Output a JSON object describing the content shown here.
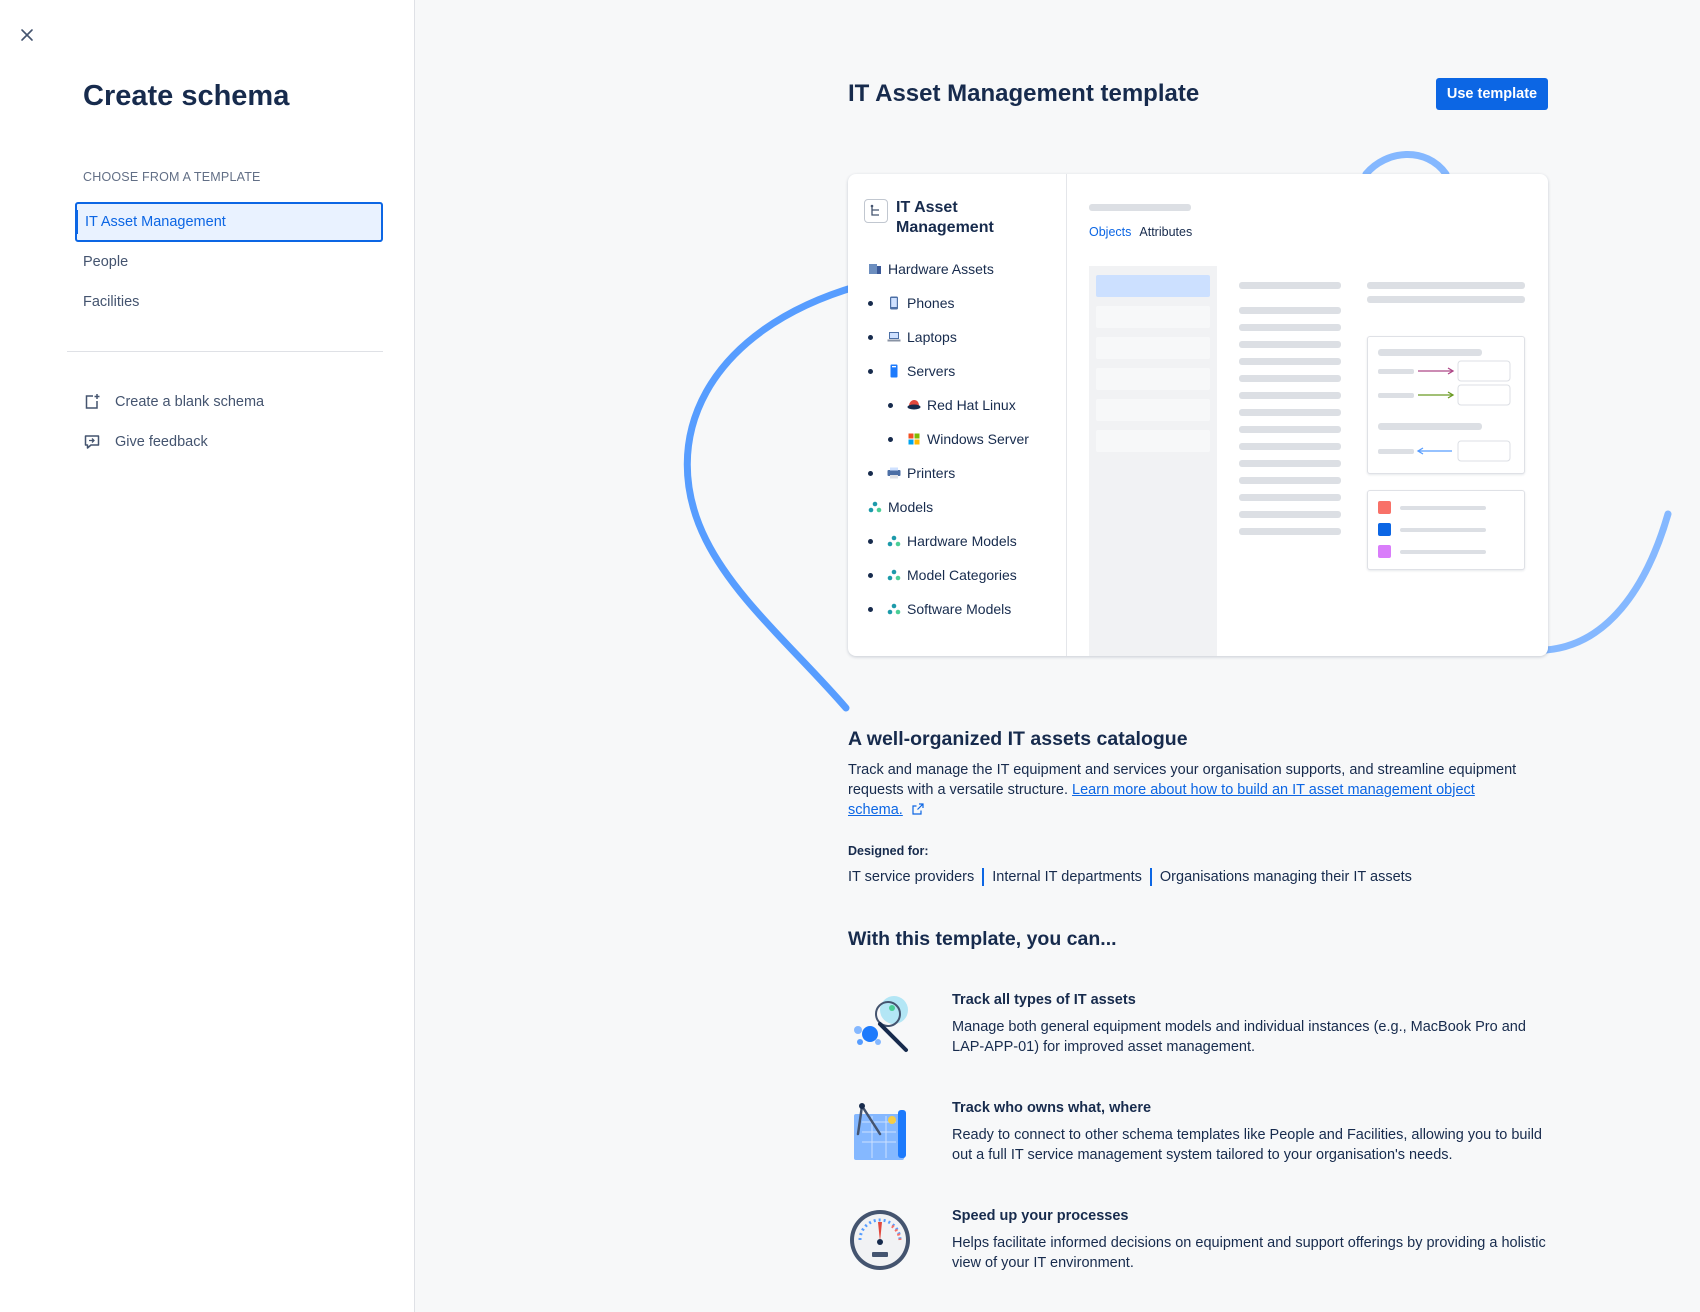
{
  "sidebar": {
    "title": "Create schema",
    "section_label": "CHOOSE FROM A TEMPLATE",
    "templates": [
      {
        "label": "IT Asset Management",
        "selected": true
      },
      {
        "label": "People",
        "selected": false
      },
      {
        "label": "Facilities",
        "selected": false
      }
    ],
    "actions": {
      "blank": "Create a blank schema",
      "feedback": "Give feedback"
    }
  },
  "main": {
    "title": "IT Asset Management template",
    "use_button": "Use template",
    "preview": {
      "tree_title": "IT Asset Management",
      "tabs": [
        "Objects",
        "Attributes"
      ],
      "tree": [
        {
          "label": "Hardware Assets",
          "level": 0,
          "icon": "server-rack-icon"
        },
        {
          "label": "Phones",
          "level": 1,
          "icon": "phone-icon"
        },
        {
          "label": "Laptops",
          "level": 1,
          "icon": "laptop-icon"
        },
        {
          "label": "Servers",
          "level": 1,
          "icon": "server-icon"
        },
        {
          "label": "Red Hat Linux",
          "level": 2,
          "icon": "redhat-icon"
        },
        {
          "label": "Windows Server",
          "level": 2,
          "icon": "windows-icon"
        },
        {
          "label": "Printers",
          "level": 1,
          "icon": "printer-icon"
        },
        {
          "label": "Models",
          "level": 0,
          "icon": "models-icon"
        },
        {
          "label": "Hardware Models",
          "level": 1,
          "icon": "models-icon"
        },
        {
          "label": "Model Categories",
          "level": 1,
          "icon": "models-icon"
        },
        {
          "label": "Software Models",
          "level": 1,
          "icon": "models-icon"
        }
      ]
    },
    "catalogue": {
      "heading": "A well-organized IT assets catalogue",
      "text": "Track and manage the IT equipment and services your organisation supports, and streamline equipment requests with a versatile structure. ",
      "link": "Learn more about how to build an IT asset management object schema."
    },
    "designed_for": {
      "label": "Designed for:",
      "items": [
        "IT service providers",
        "Internal IT departments",
        "Organisations managing their IT assets"
      ]
    },
    "features_heading": "With this template, you can...",
    "features": [
      {
        "title": "Track all types of IT assets",
        "text": "Manage both general equipment models and individual instances (e.g., MacBook Pro and LAP-APP-01) for improved asset management.",
        "icon": "magnifier-assets-icon"
      },
      {
        "title": "Track who owns what, where",
        "text": "Ready to connect to other schema templates like People and Facilities, allowing you to build out a full IT service management system tailored to your organisation's needs.",
        "icon": "blueprint-icon"
      },
      {
        "title": "Speed up your processes",
        "text": "Helps facilitate informed decisions on equipment and support offerings by providing a holistic view of your IT environment.",
        "icon": "speedometer-icon"
      }
    ],
    "colors": {
      "accent": "#0c66e4",
      "decoration": "#579dff"
    }
  }
}
